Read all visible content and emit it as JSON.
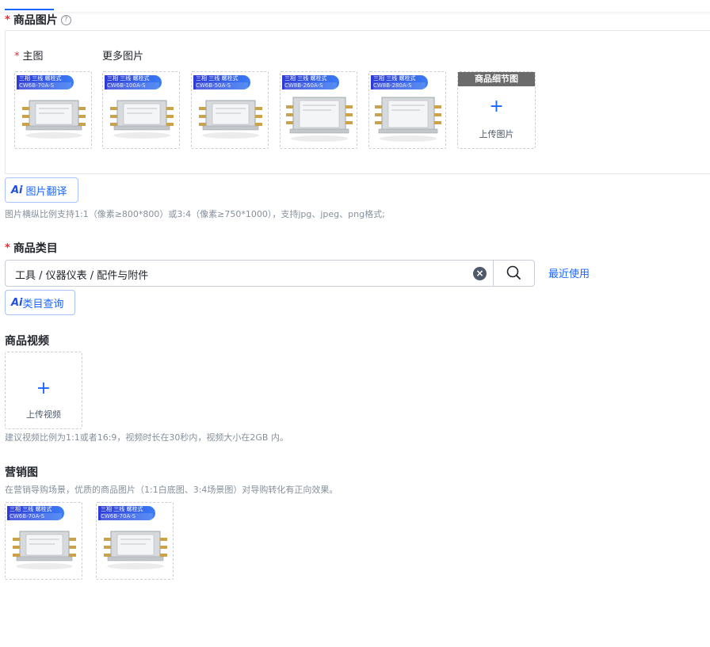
{
  "product_images": {
    "title": "商品图片",
    "help_icon": "question-circle-icon",
    "main_label": "主图",
    "more_label": "更多图片",
    "thumbnails": [
      {
        "badge_line1": "三相 三线 螺栓式",
        "badge_line2": "CW6B-70A-S",
        "variant": "small"
      },
      {
        "badge_line1": "三相 三线 螺栓式",
        "badge_line2": "CW6B-100A-S",
        "variant": "small"
      },
      {
        "badge_line1": "三相 三线 螺栓式",
        "badge_line2": "CW6B-50A-S",
        "variant": "small"
      },
      {
        "badge_line1": "三相 三线 螺栓式",
        "badge_line2": "CW8B-260A-S",
        "variant": "large"
      },
      {
        "badge_line1": "三相 三线 螺栓式",
        "badge_line2": "CW8B-280A-S",
        "variant": "large"
      }
    ],
    "detail_header": "商品细节图",
    "upload_label": "上传图片",
    "ai_translate_label": "图片翻译",
    "hint": "图片横纵比例支持1:1（像素≥800*800）或3:4（像素≥750*1000），支持jpg、jpeg、png格式;"
  },
  "category": {
    "title": "商品类目",
    "value": "工具 / 仪器仪表 / 配件与附件",
    "clear_icon": "clear-circle-icon",
    "search_icon": "search-icon",
    "recent_link": "最近使用",
    "ai_query_label": "类目查询"
  },
  "video": {
    "title": "商品视频",
    "upload_label": "上传视频",
    "hint": "建议视频比例为1:1或者16:9，视频时长在30秒内，视频大小在2GB 内。"
  },
  "marketing": {
    "title": "营销图",
    "hint": "在营销导购场景，优质的商品图片（1:1白底图、3:4场景图）对导购转化有正向效果。",
    "thumbnails": [
      {
        "badge_line1": "三相 三线 螺栓式",
        "badge_line2": "CW6B-70A-S",
        "variant": "small"
      },
      {
        "badge_line1": "三相 三线 螺栓式",
        "badge_line2": "CW6B-70A-S",
        "variant": "small"
      }
    ]
  },
  "ai_mark": "Ai",
  "colors": {
    "accent": "#1966ff",
    "required": "#f5222d",
    "hint": "#86909c"
  }
}
